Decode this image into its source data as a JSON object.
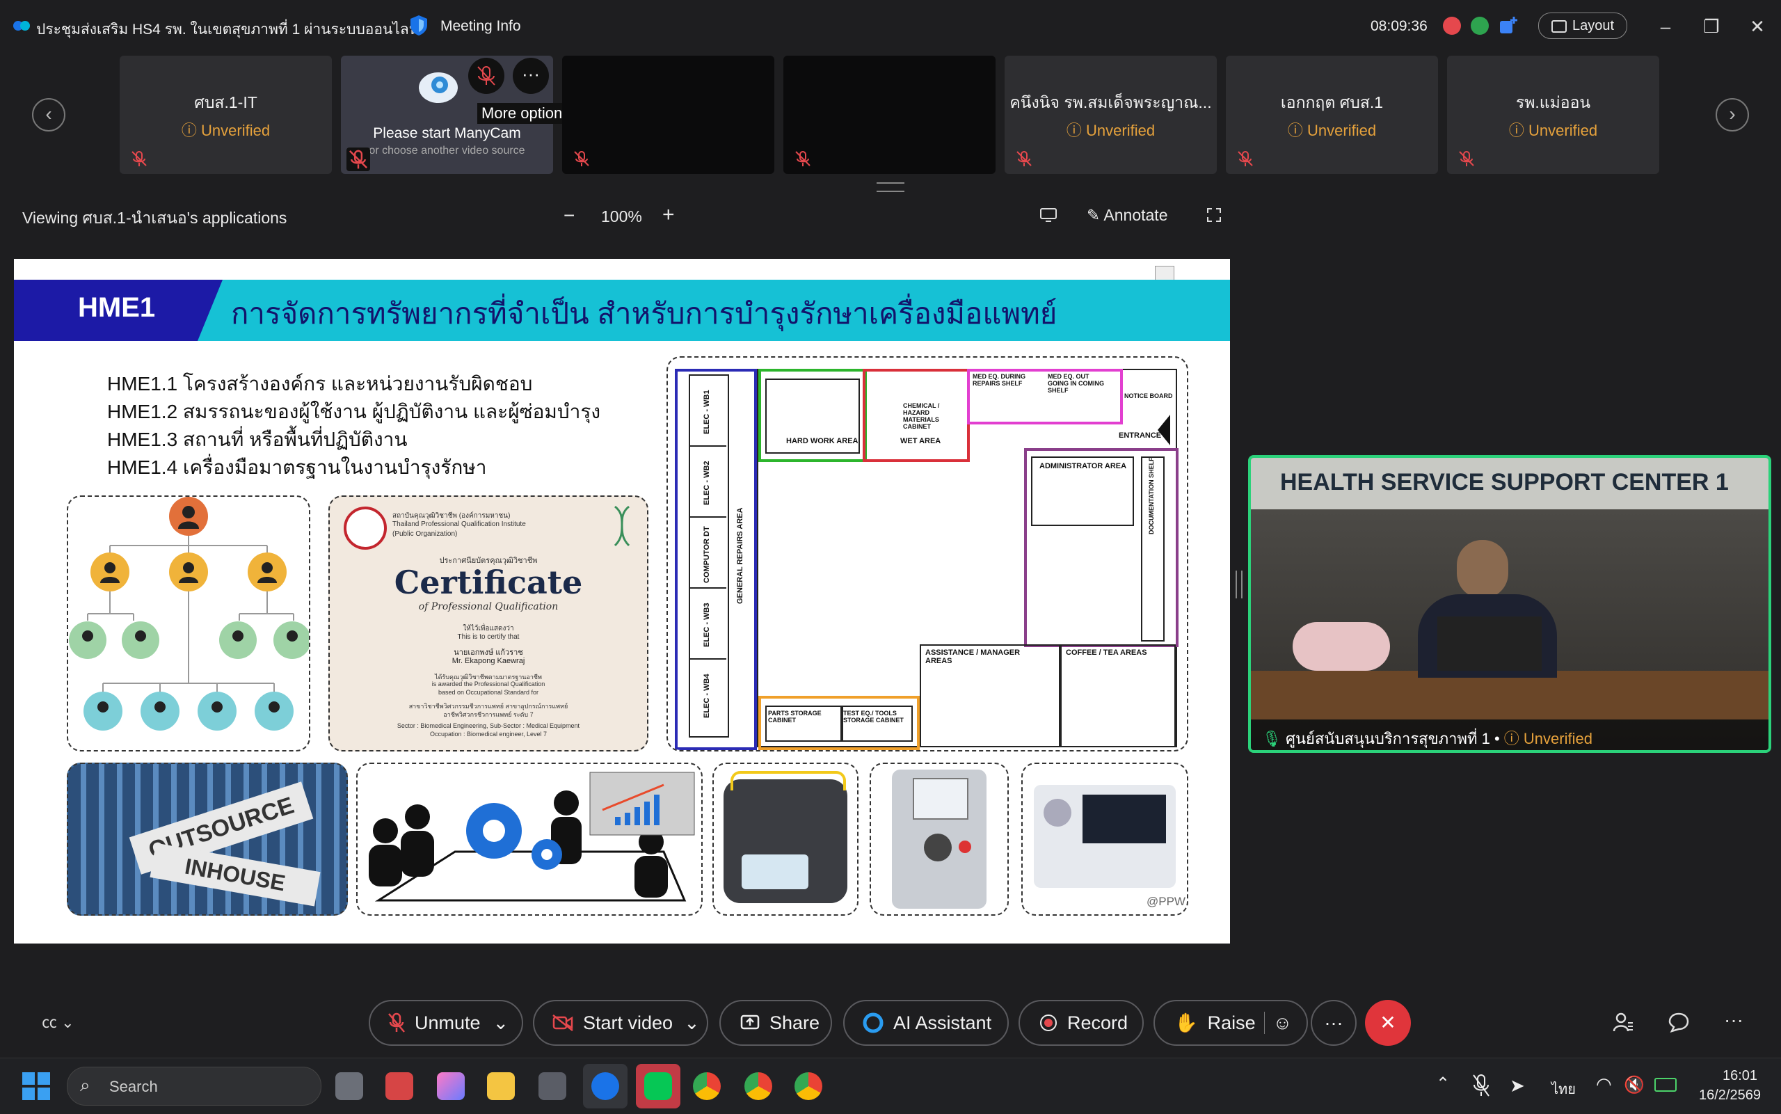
{
  "window": {
    "meeting_title": "ประชุมส่งเสริม HS4 รพ. ในเขตสุขภาพที่ 1 ผ่านระบบออนไลน์",
    "meeting_info_label": "Meeting Info",
    "clock": "08:09:36",
    "layout_label": "Layout"
  },
  "participants": {
    "tiles": [
      {
        "name": "ศบส.1-IT",
        "badge": "Unverified"
      },
      {
        "name": "",
        "badge": "",
        "video_text": "Please start ManyCam",
        "video_subtext": "or choose another video source"
      },
      {
        "name": "",
        "badge": ""
      },
      {
        "name": "",
        "badge": ""
      },
      {
        "name": "คนึงนิจ รพ.สมเด็จพระญาณ...",
        "badge": "Unverified"
      },
      {
        "name": "เอกกฤต ศบส.1",
        "badge": "Unverified"
      },
      {
        "name": "รพ.แม่ออน",
        "badge": "Unverified"
      }
    ],
    "tooltip": "More options"
  },
  "viewbar": {
    "viewing_text": "Viewing ศบส.1-นำเสนอ's applications",
    "zoom": "100%",
    "annotate_label": "Annotate"
  },
  "slide": {
    "tag": "HME1",
    "title": "การจัดการทรัพยากรที่จำเป็น สำหรับการบำรุงรักษาเครื่องมือแพทย์",
    "items": [
      "HME1.1 โครงสร้างองค์กร และหน่วยงานรับผิดชอบ",
      "HME1.2 สมรรถนะของผู้ใช้งาน ผู้ปฏิบัติงาน และผู้ซ่อมบำรุง",
      "HME1.3 สถานที่ หรือพื้นที่ปฏิบัติงาน",
      "HME1.4 เครื่องมือมาตรฐานในงานบำรุงรักษา"
    ],
    "certificate": {
      "institute_th": "สถาบันคุณวุฒิวิชาชีพ (องค์การมหาชน)",
      "institute_en": "Thailand Professional Qualification Institute",
      "institute_org": "(Public Organization)",
      "small_th": "ประกาศนียบัตรคุณวุฒิวิชาชีพ",
      "heading": "Certificate",
      "subheading": "of Professional Qualification",
      "certify_th": "ให้ไว้เพื่อแสดงว่า",
      "certify_en": "This is to certify that",
      "name_th": "นายเอกพงษ์ แก้วราช",
      "name_en": "Mr. Ekapong Kaewraj",
      "line1": "ได้รับคุณวุฒิวิชาชีพตามมาตรฐานอาชีพ",
      "line2": "is awarded the Professional Qualification",
      "line3": "based on Occupational Standard for",
      "line4": "สาขาวิชาชีพวิศวกรรมชีวการแพทย์ สาขาอุปกรณ์การแพทย์",
      "line5": "อาชีพวิศวกรชีวการแพทย์ ระดับ 7",
      "line6": "Sector : Biomedical Engineering, Sub-Sector : Medical Equipment",
      "line7": "Occupation : Biomedical engineer, Level 7"
    },
    "floorplan": {
      "general_repairs": "GENERAL REPAIRS AREA",
      "benches": [
        "ELEC - WB1",
        "ELEC - WB2",
        "COMPUTOR DT",
        "ELEC - WB3",
        "ELEC - WB4"
      ],
      "hard_work": "HARD WORK AREA",
      "chemical": "CHEMICAL / HAZARD MATERIALS CABINET",
      "wet": "WET AREA",
      "med_repairs": "MED EQ. DURING REPAIRS SHELF",
      "med_outgoing": "MED EQ. OUT GOING IN COMING SHELF",
      "notice": "NOTICE BOARD",
      "entrance": "ENTRANCE",
      "admin": "ADMINISTRATOR AREA",
      "documentation": "DOCUMENTATION SHELF",
      "assistance": "ASSISTANCE / MANAGER AREAS",
      "coffee": "COFFEE / TEA AREAS",
      "parts": "PARTS STORAGE CABINET",
      "test_eq": "TEST EQ./ TOOLS STORAGE CABINET"
    },
    "outsource": "OUTSOURCE",
    "inhouse": "INHOUSE",
    "watermark": "@PPW"
  },
  "selfview": {
    "banner": "HEALTH SERVICE SUPPORT CENTER 1",
    "name": "ศูนย์สนับสนุนบริการสุขภาพที่ 1",
    "badge": "Unverified"
  },
  "controls": {
    "unmute": "Unmute",
    "start_video": "Start video",
    "share": "Share",
    "ai_assistant": "AI Assistant",
    "record": "Record",
    "raise": "Raise"
  },
  "taskbar": {
    "search_placeholder": "Search",
    "lang": "ไทย",
    "time": "16:01",
    "date": "16/2/2569"
  },
  "colors": {
    "accent_green": "#2bd27a",
    "warning": "#e6a23c",
    "end_call": "#e0353b",
    "slide_header": "#16c1d5",
    "slide_tag": "#1c1aa6"
  }
}
